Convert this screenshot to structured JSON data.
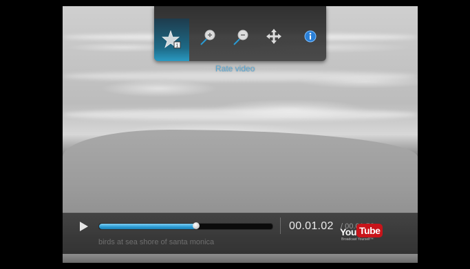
{
  "toolbar": {
    "buttons": [
      {
        "name": "rate-video",
        "icon": "star-rating-icon",
        "active": true
      },
      {
        "name": "zoom-in",
        "icon": "zoom-in-icon",
        "active": false
      },
      {
        "name": "zoom-out",
        "icon": "zoom-out-icon",
        "active": false
      },
      {
        "name": "move",
        "icon": "move-arrows-icon",
        "active": false
      },
      {
        "name": "info",
        "icon": "info-icon",
        "active": false
      }
    ],
    "tooltip": "Rate video"
  },
  "player": {
    "progress": 0.56,
    "time_current": "00.01.02",
    "time_total": "/ 00.01.52",
    "caption": "birds at sea shore of santa monica"
  },
  "brand": {
    "you": "You",
    "tube": "Tube",
    "tagline": "Broadcast Yourself™"
  },
  "colors": {
    "accent": "#2a9ad2",
    "brand_red": "#c8141a"
  }
}
